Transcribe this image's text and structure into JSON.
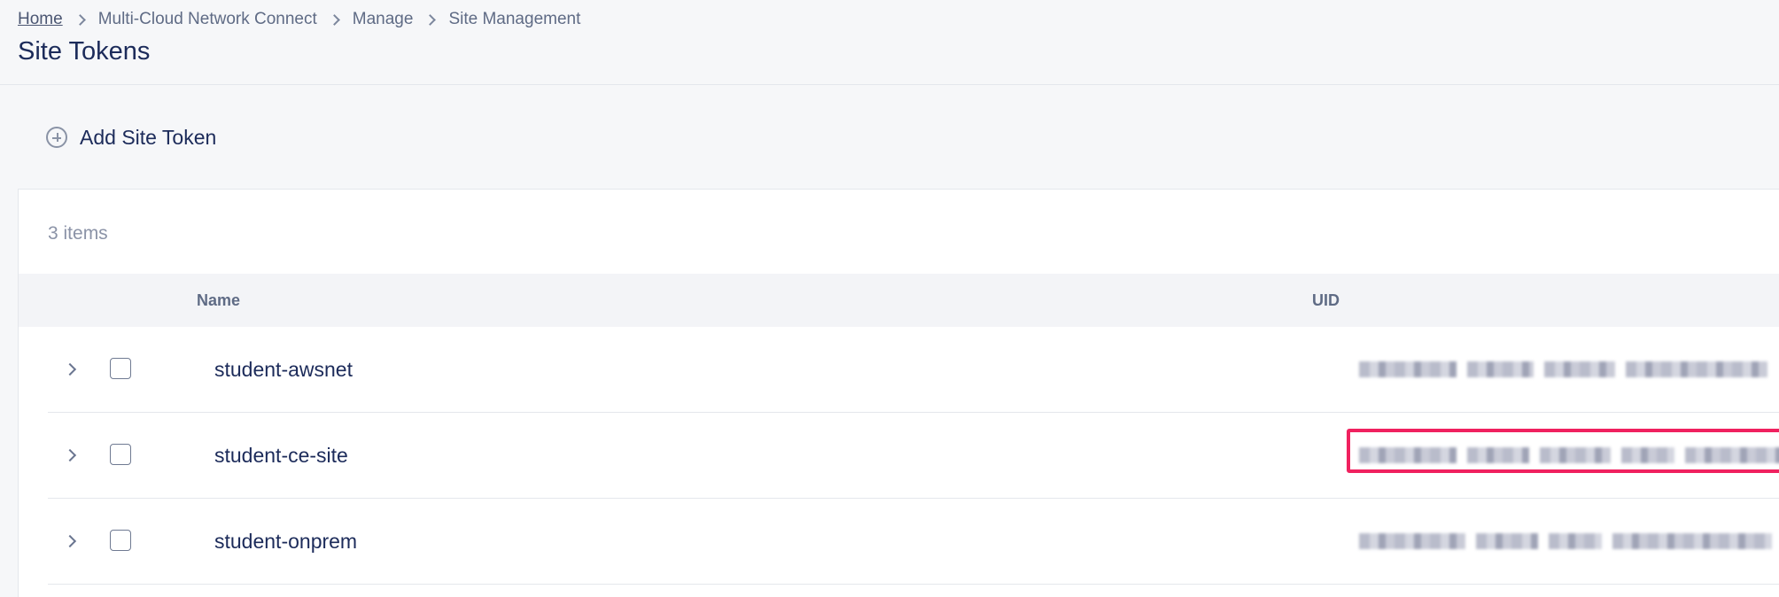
{
  "breadcrumb": {
    "home": "Home",
    "items": [
      "Multi-Cloud Network Connect",
      "Manage",
      "Site Management"
    ]
  },
  "page": {
    "title": "Site Tokens"
  },
  "toolbar": {
    "add_label": "Add Site Token",
    "add_icon": "plus-circle-icon"
  },
  "list": {
    "count_label": "3 items",
    "columns": {
      "name": "Name",
      "uid": "UID"
    },
    "rows": [
      {
        "name": "student-awsnet",
        "uid_highlighted": false
      },
      {
        "name": "student-ce-site",
        "uid_highlighted": true
      },
      {
        "name": "student-onprem",
        "uid_highlighted": false
      }
    ]
  },
  "colors": {
    "highlight": "#f0215f",
    "title": "#1c2b5a"
  }
}
